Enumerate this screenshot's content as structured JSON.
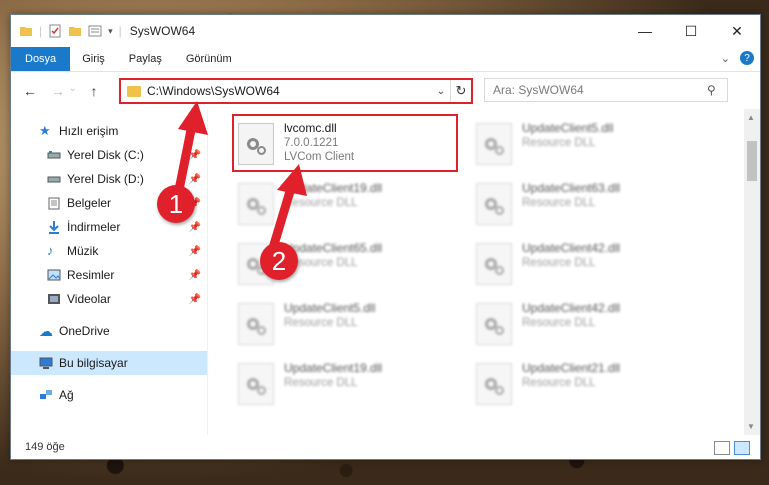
{
  "window": {
    "title": "SysWOW64"
  },
  "ribbon": {
    "tabs": [
      "Dosya",
      "Giriş",
      "Paylaş",
      "Görünüm"
    ]
  },
  "address": {
    "path": "C:\\Windows\\SysWOW64"
  },
  "search": {
    "placeholder": "Ara: SysWOW64"
  },
  "sidebar": {
    "quick_access": "Hızlı erişim",
    "items": [
      {
        "label": "Yerel Disk (C:)",
        "icon": "drive-icon"
      },
      {
        "label": "Yerel Disk (D:)",
        "icon": "drive-icon"
      },
      {
        "label": "Belgeler",
        "icon": "documents-icon"
      },
      {
        "label": "İndirmeler",
        "icon": "download-icon"
      },
      {
        "label": "Müzik",
        "icon": "music-icon"
      },
      {
        "label": "Resimler",
        "icon": "pictures-icon"
      },
      {
        "label": "Videolar",
        "icon": "video-icon"
      }
    ],
    "onedrive": "OneDrive",
    "this_pc": "Bu bilgisayar",
    "network": "Ağ"
  },
  "files": [
    {
      "name": "lvcomc.dll",
      "line2": "7.0.0.1221",
      "line3": "LVCom Client"
    },
    {
      "name": "UpdateClient5.dll",
      "line2": "Resource DLL"
    },
    {
      "name": "UpdateClient19.dll",
      "line2": "Resource DLL"
    },
    {
      "name": "UpdateClient63.dll",
      "line2": "Resource DLL"
    },
    {
      "name": "UpdateClient65.dll",
      "line2": "Resource DLL"
    },
    {
      "name": "UpdateClient42.dll",
      "line2": "Resource DLL"
    },
    {
      "name": "UpdateClient5.dll",
      "line2": "Resource DLL"
    },
    {
      "name": "UpdateClient42.dll",
      "line2": "Resource DLL"
    },
    {
      "name": "UpdateClient19.dll",
      "line2": "Resource DLL"
    },
    {
      "name": "UpdateClient21.dll",
      "line2": "Resource DLL"
    }
  ],
  "status": {
    "count": "149 öğe"
  },
  "annotations": {
    "step1": "1",
    "step2": "2",
    "color": "#e0202a"
  }
}
